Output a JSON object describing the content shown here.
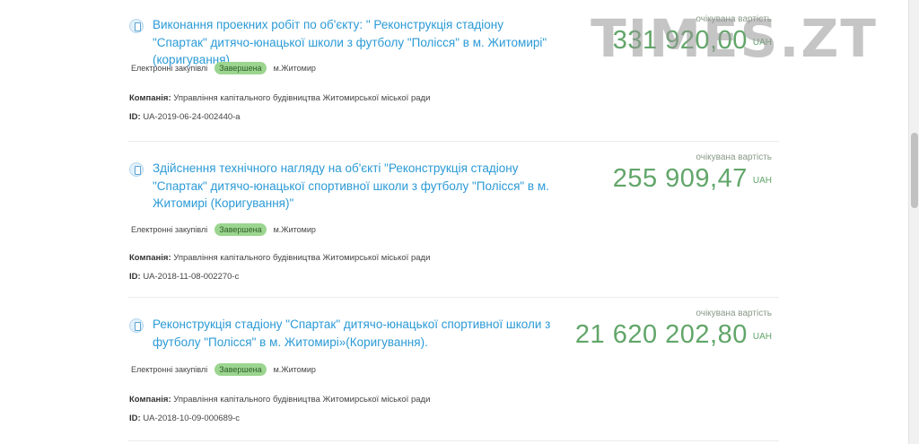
{
  "watermark": "TIMES.ZT",
  "results": [
    {
      "title": "Виконання проекних робіт по об'єкту: \" Реконструкція стадіону \"Спартак\" дитячо-юнацької школи з футболу \"Полісся\" в м. Житомирі\" (коригування)",
      "procurement_type": "Електронні закупівлі",
      "status": "Завершена",
      "city": "м.Житомир",
      "company_label": "Компанія:",
      "company": "Управління капітального будівництва Житомирської міської ради",
      "id_label": "ID:",
      "id": "UA-2019-06-24-002440-a",
      "price_label": "очікувана вартість",
      "price": "331 920,00",
      "currency": "UAH"
    },
    {
      "title": "Здійснення технічного нагляду на об'єкті \"Реконструкція стадіону \"Спартак\" дитячо-юнацької спортивної школи з футболу \"Полісся\" в м. Житомирі (Коригування)\"",
      "procurement_type": "Електронні закупівлі",
      "status": "Завершена",
      "city": "м.Житомир",
      "company_label": "Компанія:",
      "company": "Управління капітального будівництва Житомирської міської ради",
      "id_label": "ID:",
      "id": "UA-2018-11-08-002270-c",
      "price_label": "очікувана вартість",
      "price": "255 909,47",
      "currency": "UAH"
    },
    {
      "title": "Реконструкція стадіону \"Спартак\" дитячо-юнацької спортивної школи з футболу \"Полісся\" в м. Житомирі»(Коригування).",
      "procurement_type": "Електронні закупівлі",
      "status": "Завершена",
      "city": "м.Житомир",
      "company_label": "Компанія:",
      "company": "Управління капітального будівництва Житомирської міської ради",
      "id_label": "ID:",
      "id": "UA-2018-10-09-000689-c",
      "price_label": "очікувана вартість",
      "price": "21 620 202,80",
      "currency": "UAH"
    }
  ]
}
